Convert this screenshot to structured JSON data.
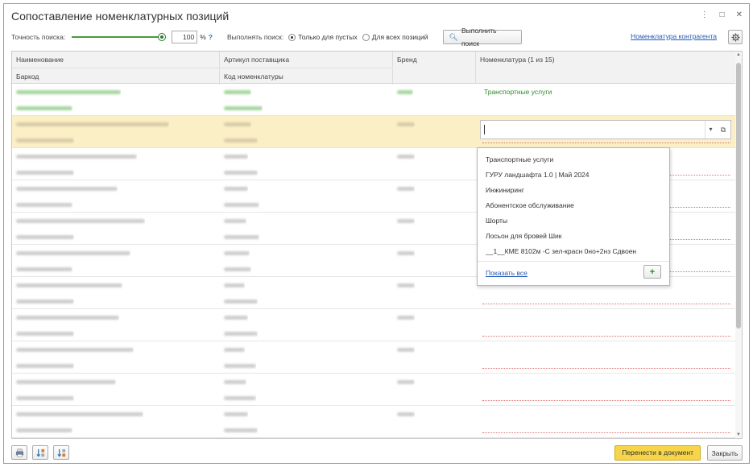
{
  "window": {
    "title": "Сопоставление номенклатурных позиций",
    "more": "⋮",
    "maximize": "□",
    "close": "✕"
  },
  "toolbar": {
    "accuracy_label": "Точность поиска:",
    "accuracy_value": "100",
    "accuracy_level_percent": 100,
    "percent_sign": "%",
    "help": "?",
    "mode_label": "Выполнять поиск:",
    "mode_options": [
      "Только для пустых",
      "Для всех позиций"
    ],
    "mode_selected": "Только для пустых",
    "search_button": "Выполнить поиск",
    "counterparty_link": "Номенклатура контрагента"
  },
  "table": {
    "headers": {
      "name": "Наименование",
      "barcode": "Баркод",
      "article": "Артикул поставщика",
      "code": "Код номенклатуры",
      "brand": "Бренд",
      "nomenclature": "Номенклатура (1 из 15)"
    },
    "first_row_nomenclature": "Транспортные услуги"
  },
  "dropdown": {
    "items": [
      "Транспортные услуги",
      "ГУРУ ландшафта 1.0 | Май 2024",
      "Инжиниринг",
      "Абонентское обслуживание",
      "Шорты",
      "Лосьон для бровей Шик",
      "__1__КМЕ 8102м -С зел-красн 0но+2нз Сдвоен"
    ],
    "show_all": "Показать все",
    "add": "+"
  },
  "footer": {
    "transfer_button": "Перенести в документ",
    "close_button": "Закрыть"
  },
  "colors": {
    "accent_yellow": "#f7d54a",
    "selected_row": "#fbefc6",
    "link": "#2459b3",
    "green": "#2f8a2f"
  }
}
